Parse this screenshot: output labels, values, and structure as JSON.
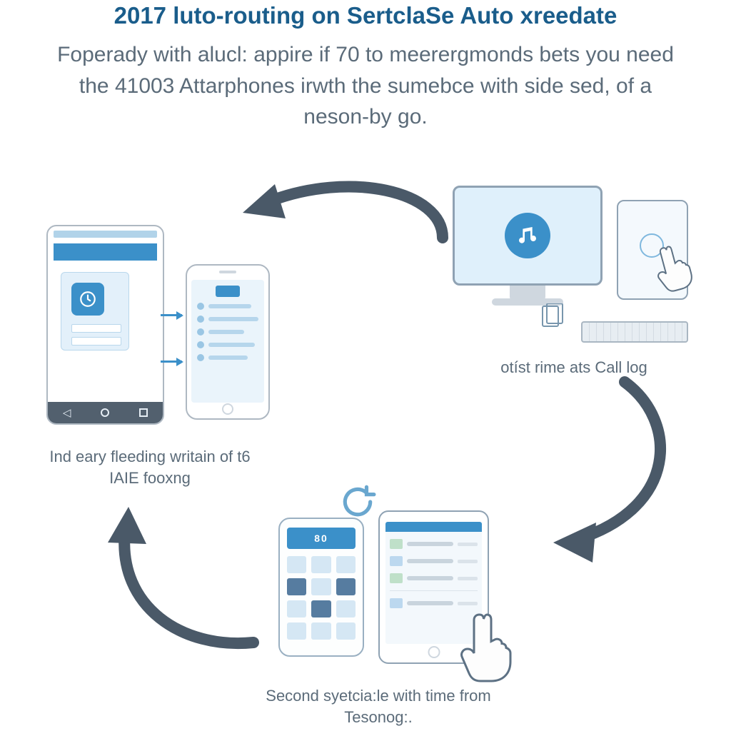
{
  "title": "2017 luto-routing on SertclaSe Auto xreedate",
  "subtitle": "Foperady with alucl: appire if 70 to meerergmonds bets you need the 41003 Attarphones irwth the sumebce with side sed, of a neson-by go.",
  "nodes": {
    "phones": {
      "caption": "Ind eary fleeding writain of t6 IAIE fooxng"
    },
    "desktop": {
      "caption": "otíst rime ats Call log"
    },
    "bottom": {
      "caption": "Second syetcia:le with time from Tesonog:."
    }
  },
  "keypad_display": "80",
  "colors": {
    "accent": "#3b90c9",
    "arrow": "#4a5968",
    "text": "#5b6b79"
  }
}
